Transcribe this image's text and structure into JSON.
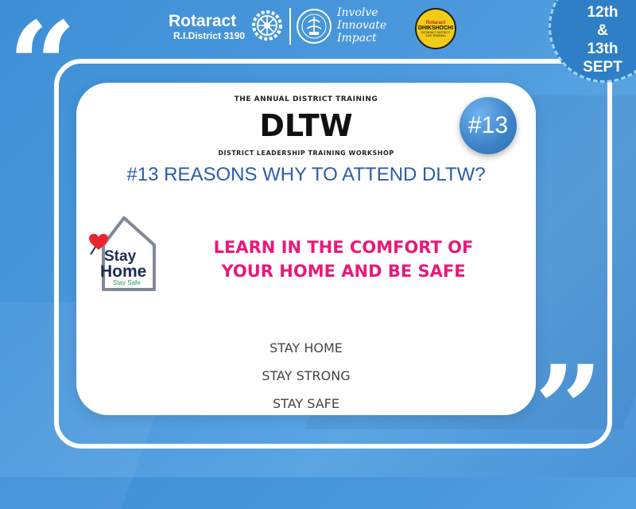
{
  "header": {
    "org_name": "Rotaract",
    "district": "R.I.District 3190",
    "motto": [
      "Involve",
      "Innovate",
      "Impact"
    ],
    "badge": {
      "top": "Rotaract",
      "main": "DHIKSHOCHI",
      "sub": "ROTARACT DISTRICT 3190 TRAINING"
    }
  },
  "date": {
    "line1": "12th",
    "line2": "&",
    "line3": "13th",
    "line4": "SEPT"
  },
  "card": {
    "annual": "THE ANNUAL DISTRICT TRAINING",
    "title": "DLTW",
    "subtitle": "DISTRICT LEADERSHIP TRAINING WORKSHOP",
    "reasons": "#13 REASONS WHY TO ATTEND DLTW?",
    "number_badge": "#13",
    "stay_home_logo": {
      "line1": "Stay",
      "line2": "Home",
      "line3": "Stay Safe"
    },
    "message_line1": "LEARN IN THE COMFORT OF",
    "message_line2": "YOUR HOME AND BE SAFE",
    "taglines": [
      "STAY HOME",
      "STAY STRONG",
      "STAY SAFE"
    ]
  },
  "icons": [
    "quote-open-icon",
    "quote-close-icon",
    "rotary-wheel-icon",
    "seal-icon",
    "heart-icon",
    "house-icon"
  ],
  "colors": {
    "background": "#4a98dc",
    "title_blue": "#2b5da8",
    "message_pink": "#e8197a",
    "badge_yellow": "#f2cb16"
  }
}
